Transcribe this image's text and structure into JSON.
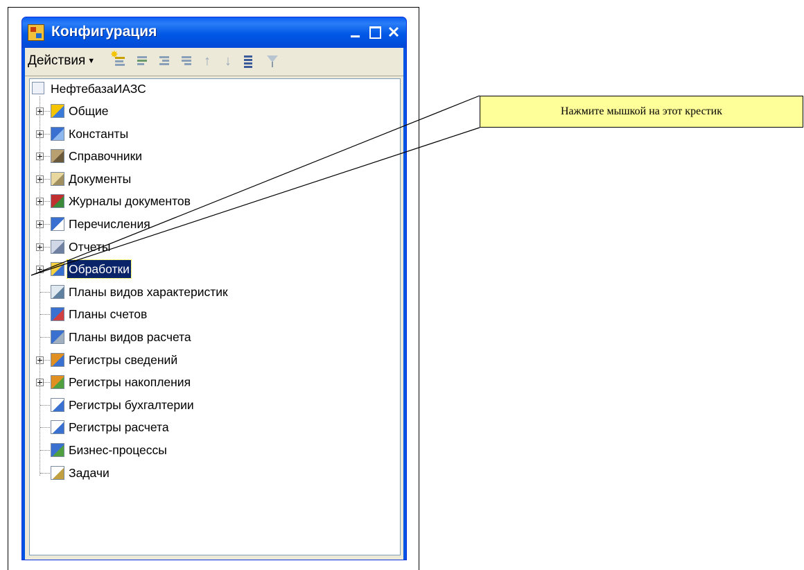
{
  "window": {
    "title": "Конфигурация",
    "toolbar": {
      "actions_label": "Действия",
      "icons": [
        "new-item-icon",
        "edit-item-icon",
        "add-child-icon",
        "delete-item-icon",
        "move-up-icon",
        "move-down-icon",
        "sort-icon",
        "filter-icon"
      ]
    }
  },
  "tree": {
    "root": "НефтебазаИАЗС",
    "items": [
      {
        "label": "Общие",
        "expandable": true,
        "icon": "common-icon"
      },
      {
        "label": "Константы",
        "expandable": true,
        "icon": "constants-icon"
      },
      {
        "label": "Справочники",
        "expandable": true,
        "icon": "catalogs-icon"
      },
      {
        "label": "Документы",
        "expandable": true,
        "icon": "documents-icon"
      },
      {
        "label": "Журналы документов",
        "expandable": true,
        "icon": "journals-icon"
      },
      {
        "label": "Перечисления",
        "expandable": true,
        "icon": "enums-icon"
      },
      {
        "label": "Отчеты",
        "expandable": true,
        "icon": "reports-icon"
      },
      {
        "label": "Обработки",
        "expandable": true,
        "icon": "dataprocessors-icon",
        "selected": true
      },
      {
        "label": "Планы видов характеристик",
        "expandable": false,
        "icon": "chart-of-characteristics-icon"
      },
      {
        "label": "Планы счетов",
        "expandable": false,
        "icon": "chart-of-accounts-icon"
      },
      {
        "label": "Планы видов расчета",
        "expandable": false,
        "icon": "chart-of-calculation-icon"
      },
      {
        "label": "Регистры сведений",
        "expandable": true,
        "icon": "info-registers-icon"
      },
      {
        "label": "Регистры накопления",
        "expandable": true,
        "icon": "accumulation-registers-icon"
      },
      {
        "label": "Регистры бухгалтерии",
        "expandable": false,
        "icon": "accounting-registers-icon"
      },
      {
        "label": "Регистры расчета",
        "expandable": false,
        "icon": "calculation-registers-icon"
      },
      {
        "label": "Бизнес-процессы",
        "expandable": false,
        "icon": "business-processes-icon"
      },
      {
        "label": "Задачи",
        "expandable": false,
        "icon": "tasks-icon"
      }
    ]
  },
  "callout": {
    "text": "Нажмите мышкой на этот крестик"
  },
  "colors": {
    "title_bar": "#0054e3",
    "selection": "#0a246a",
    "callout_bg": "#ffff99"
  }
}
